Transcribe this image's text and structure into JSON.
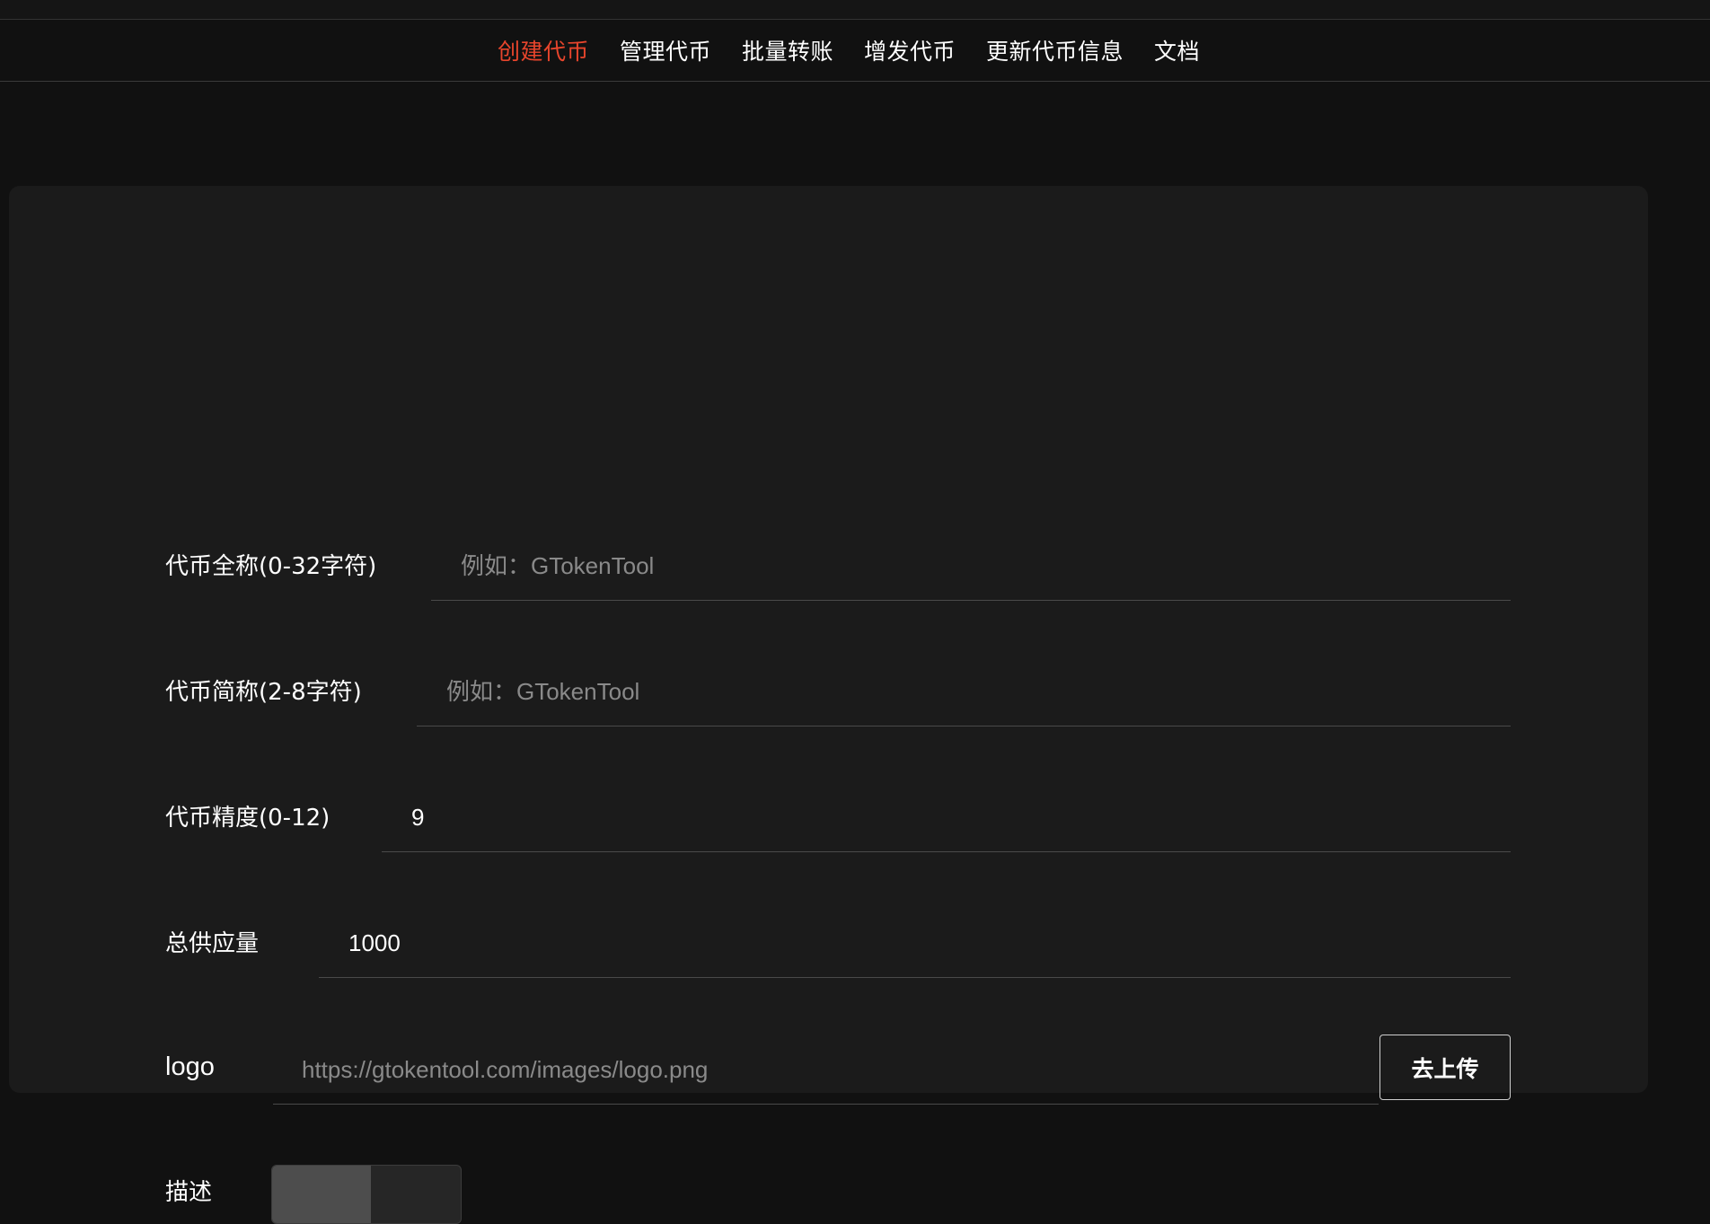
{
  "nav": {
    "items": [
      {
        "label": "创建代币",
        "active": true
      },
      {
        "label": "管理代币",
        "active": false
      },
      {
        "label": "批量转账",
        "active": false
      },
      {
        "label": "增发代币",
        "active": false
      },
      {
        "label": "更新代币信息",
        "active": false
      },
      {
        "label": "文档",
        "active": false
      }
    ],
    "active_color": "#e8452c"
  },
  "form": {
    "name": {
      "label": "代币全称(0-32字符)",
      "value": "",
      "placeholder": "例如：GTokenTool"
    },
    "symbol": {
      "label": "代币简称(2-8字符)",
      "value": "",
      "placeholder": "例如：GTokenTool"
    },
    "decimals": {
      "label": "代币精度(0-12)",
      "value": "9",
      "placeholder": ""
    },
    "supply": {
      "label": "总供应量",
      "value": "1000",
      "placeholder": ""
    },
    "logo": {
      "label": "logo",
      "value": "",
      "placeholder": "https://gtokentool.com/images/logo.png",
      "upload_label": "去上传"
    },
    "description": {
      "label": "描述",
      "toggle_on": false
    }
  }
}
